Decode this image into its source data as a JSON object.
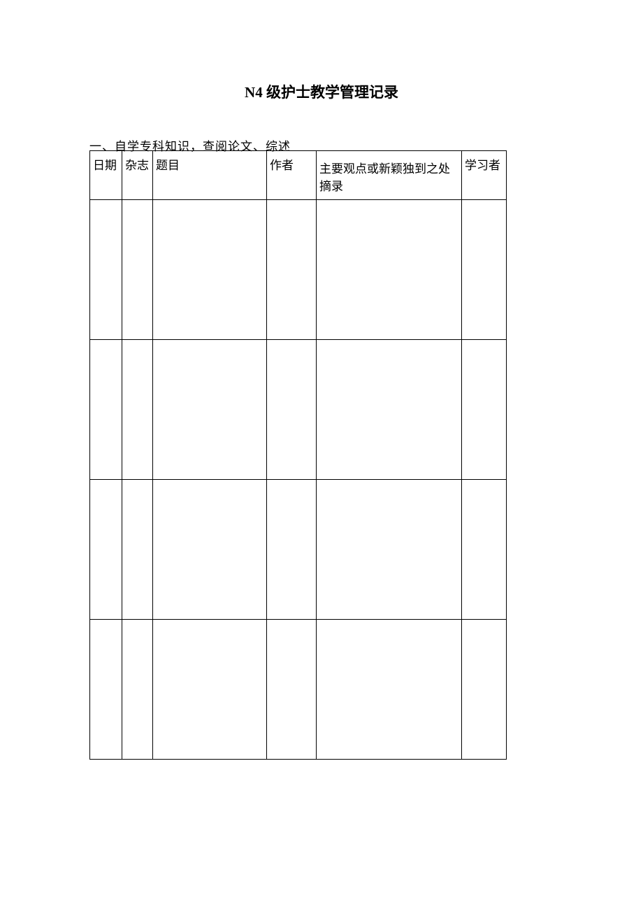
{
  "title": {
    "prefix": "N4",
    "main": " 级护士教学管理记录"
  },
  "sectionHeading": "一、自学专科知识，查阅论文、综述",
  "headers": {
    "date": "日期",
    "journal": "杂志",
    "title": "题目",
    "author": "作者",
    "summary": "主要观点或新颖独到之处摘录",
    "learner": "学习者"
  },
  "rows": [
    {
      "date": "",
      "journal": "",
      "title": "",
      "author": "",
      "summary": "",
      "learner": ""
    },
    {
      "date": "",
      "journal": "",
      "title": "",
      "author": "",
      "summary": "",
      "learner": ""
    },
    {
      "date": "",
      "journal": "",
      "title": "",
      "author": "",
      "summary": "",
      "learner": ""
    },
    {
      "date": "",
      "journal": "",
      "title": "",
      "author": "",
      "summary": "",
      "learner": ""
    }
  ]
}
